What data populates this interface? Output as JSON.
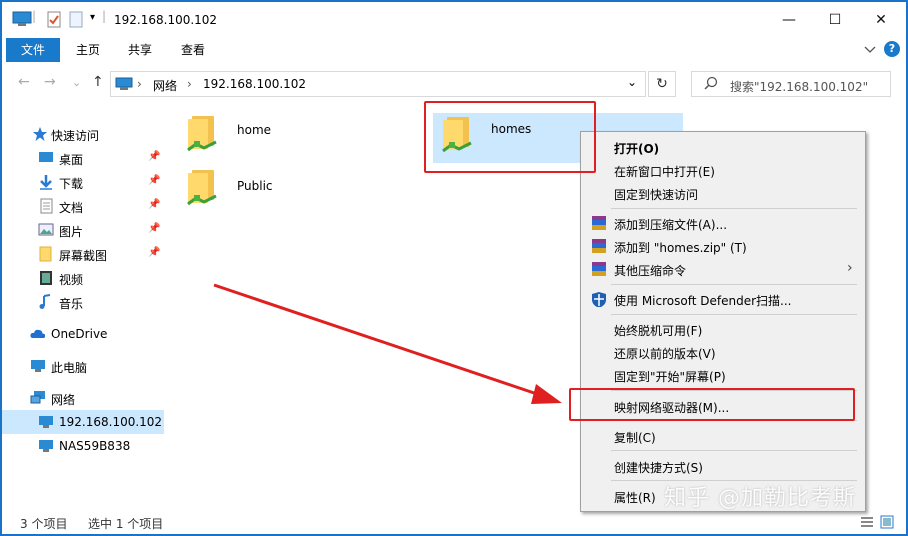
{
  "window": {
    "title": "192.168.100.102",
    "controls": {
      "minimize": "—",
      "maximize": "☐",
      "close": "✕"
    }
  },
  "ribbon": {
    "tabs": [
      "文件",
      "主页",
      "共享",
      "查看"
    ],
    "collapse_icon": "chevron-down-icon",
    "help": "?"
  },
  "address": {
    "back": "←",
    "forward": "→",
    "recent": "⌄",
    "up": "↑",
    "crumbs": [
      "网络",
      "192.168.100.102"
    ],
    "sep": "›",
    "dropdown": "⌄",
    "refresh": "↻",
    "search_placeholder": "搜索\"192.168.100.102\""
  },
  "nav": {
    "items": [
      {
        "label": "快速访问",
        "icon": "star-icon",
        "pinned": false
      },
      {
        "label": "桌面",
        "icon": "desktop-icon",
        "pinned": true
      },
      {
        "label": "下载",
        "icon": "download-icon",
        "pinned": true
      },
      {
        "label": "文档",
        "icon": "document-icon",
        "pinned": true
      },
      {
        "label": "图片",
        "icon": "picture-icon",
        "pinned": true
      },
      {
        "label": "屏幕截图",
        "icon": "folder-icon",
        "pinned": true
      },
      {
        "label": "视频",
        "icon": "video-icon",
        "pinned": false
      },
      {
        "label": "音乐",
        "icon": "music-icon",
        "pinned": false
      },
      {
        "label": "OneDrive",
        "icon": "cloud-icon",
        "pinned": false
      },
      {
        "label": "此电脑",
        "icon": "computer-icon",
        "pinned": false
      },
      {
        "label": "网络",
        "icon": "network-icon",
        "pinned": false
      },
      {
        "label": "192.168.100.102",
        "icon": "computer-icon",
        "pinned": false,
        "selected": true
      },
      {
        "label": "NAS59B838",
        "icon": "computer-icon",
        "pinned": false
      }
    ],
    "pin_glyph": "📌"
  },
  "files": [
    {
      "name": "home"
    },
    {
      "name": "Public"
    },
    {
      "name": "homes",
      "selected": true
    }
  ],
  "status": {
    "count": "3 个项目",
    "selected": "选中 1 个项目"
  },
  "context_menu": {
    "items": [
      {
        "label": "打开(O)",
        "bold": true
      },
      {
        "label": "在新窗口中打开(E)"
      },
      {
        "label": "固定到快速访问"
      },
      {
        "label": "添加到压缩文件(A)...",
        "icon": "winrar-icon"
      },
      {
        "label": "添加到 \"homes.zip\" (T)",
        "icon": "winrar-icon"
      },
      {
        "label": "其他压缩命令",
        "icon": "winrar-icon",
        "submenu": "›"
      },
      {
        "label": "使用 Microsoft Defender扫描...",
        "icon": "defender-shield-icon"
      },
      {
        "label": "始终脱机可用(F)"
      },
      {
        "label": "还原以前的版本(V)"
      },
      {
        "label": "固定到\"开始\"屏幕(P)"
      },
      {
        "label": "映射网络驱动器(M)..."
      },
      {
        "label": "复制(C)"
      },
      {
        "label": "创建快捷方式(S)"
      },
      {
        "label": "属性(R)"
      }
    ]
  },
  "watermark": "知乎 @加勒比考斯",
  "colors": {
    "accent": "#1979ca",
    "selection": "#cce8ff",
    "annotation": "#e02020"
  }
}
